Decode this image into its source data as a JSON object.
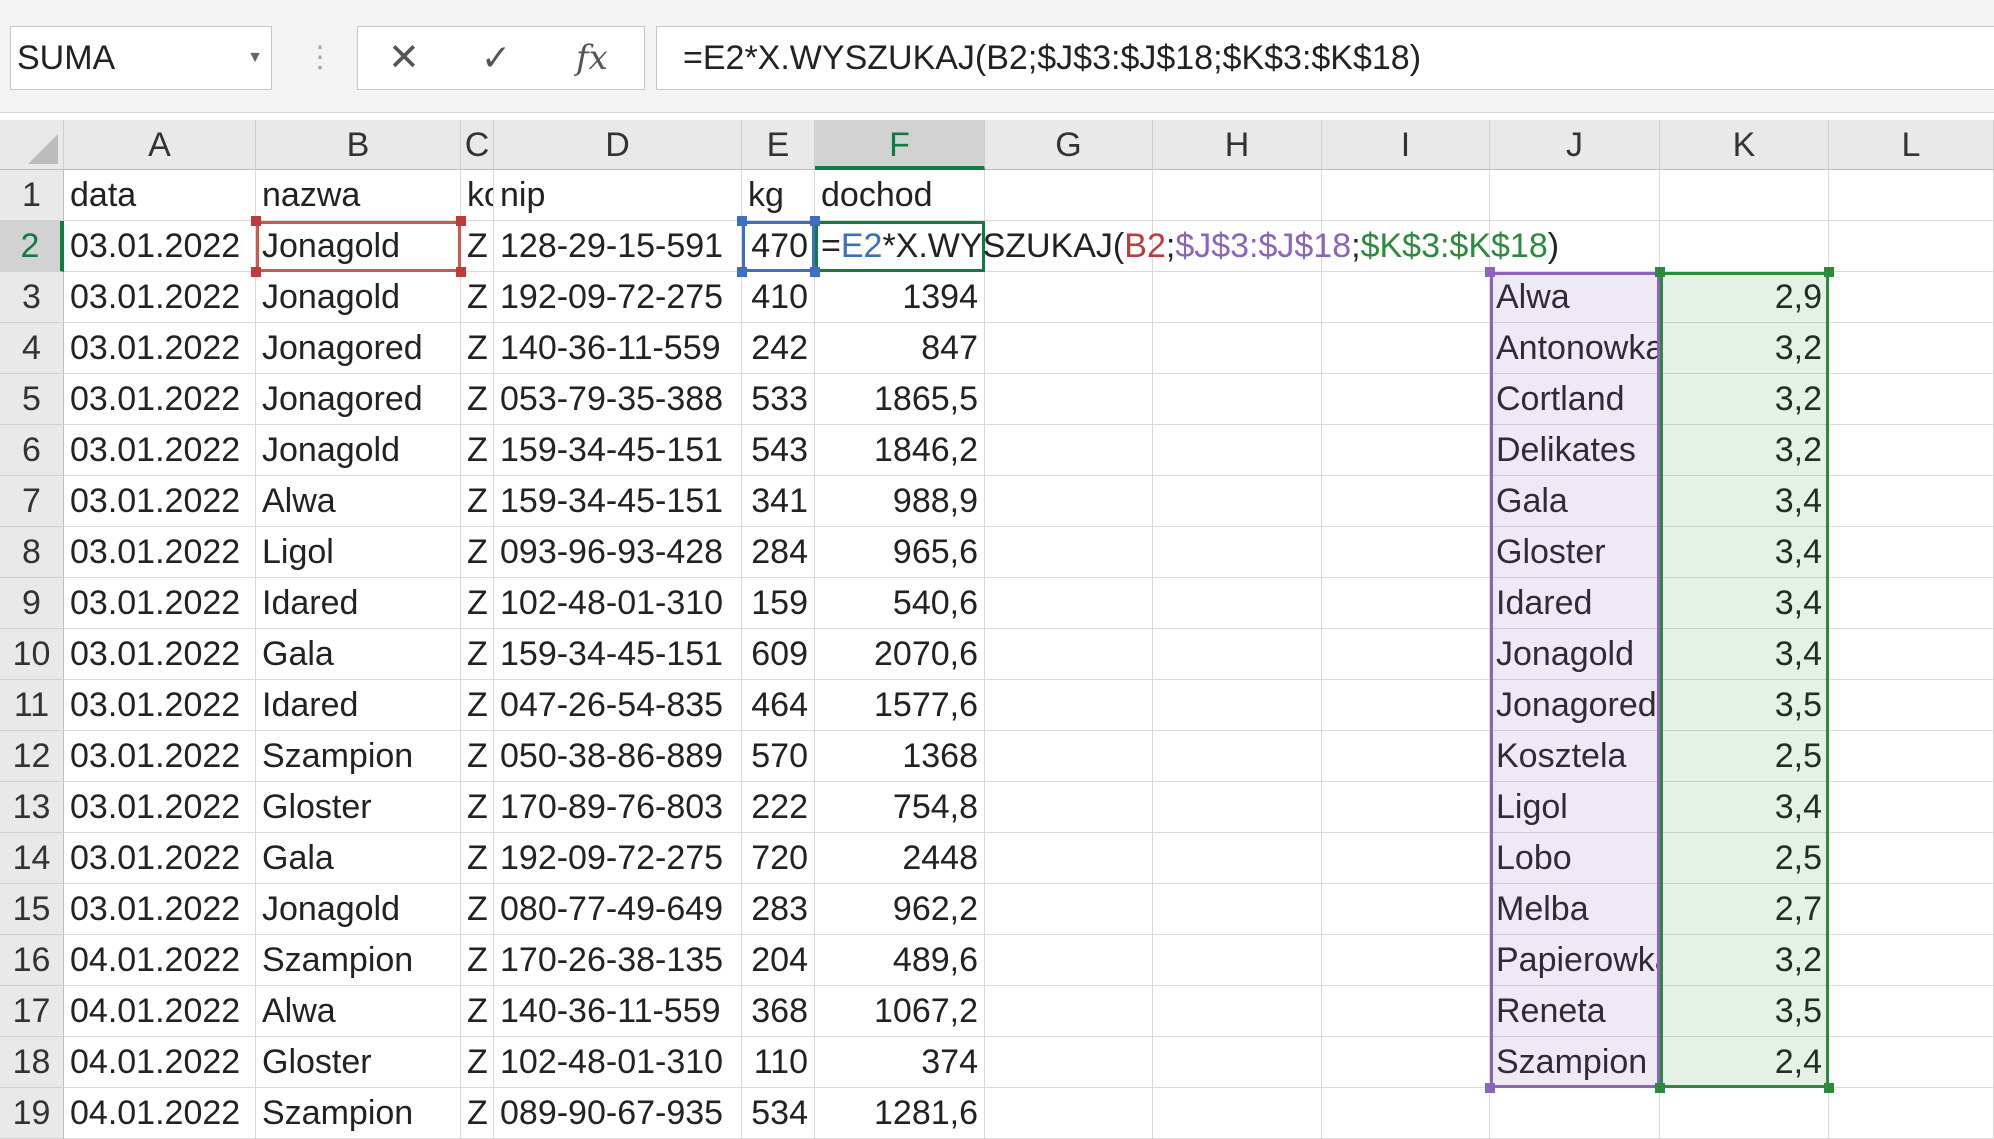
{
  "namebox": {
    "value": "SUMA"
  },
  "formula_buttons": {
    "cancel": "✕",
    "enter": "✓",
    "fx": "fx"
  },
  "formula_bar": {
    "value": "=E2*X.WYSZUKAJ(B2;$J$3:$J$18;$K$3:$K$18)"
  },
  "columns": [
    "A",
    "B",
    "C",
    "D",
    "E",
    "F",
    "G",
    "H",
    "I",
    "J",
    "K",
    "L"
  ],
  "active_column": "F",
  "active_row": 2,
  "header_row": {
    "data": "data",
    "nazwa": "nazwa",
    "c": "kod",
    "nip": "nip",
    "kg": "kg",
    "dochod": "dochod"
  },
  "edit_formula": {
    "p1": "=",
    "p2": "E2",
    "p3": "*X.WYSZUKAJ(",
    "p4": "B2",
    "p5": ";",
    "p6": "$J$3:$J$18",
    "p7": ";",
    "p8": "$K$3:$K$18",
    "p9": ")"
  },
  "rows": [
    {
      "r": "2",
      "data": "03.01.2022",
      "nazwa": "Jonagold",
      "c": "Z",
      "nip": "128-29-15-591",
      "kg": "470",
      "dochod": ""
    },
    {
      "r": "3",
      "data": "03.01.2022",
      "nazwa": "Jonagold",
      "c": "Z",
      "nip": "192-09-72-275",
      "kg": "410",
      "dochod": "1394"
    },
    {
      "r": "4",
      "data": "03.01.2022",
      "nazwa": "Jonagored",
      "c": "Z",
      "nip": "140-36-11-559",
      "kg": "242",
      "dochod": "847"
    },
    {
      "r": "5",
      "data": "03.01.2022",
      "nazwa": "Jonagored",
      "c": "Z",
      "nip": "053-79-35-388",
      "kg": "533",
      "dochod": "1865,5"
    },
    {
      "r": "6",
      "data": "03.01.2022",
      "nazwa": "Jonagold",
      "c": "Z",
      "nip": "159-34-45-151",
      "kg": "543",
      "dochod": "1846,2"
    },
    {
      "r": "7",
      "data": "03.01.2022",
      "nazwa": "Alwa",
      "c": "Z",
      "nip": "159-34-45-151",
      "kg": "341",
      "dochod": "988,9"
    },
    {
      "r": "8",
      "data": "03.01.2022",
      "nazwa": "Ligol",
      "c": "Z",
      "nip": "093-96-93-428",
      "kg": "284",
      "dochod": "965,6"
    },
    {
      "r": "9",
      "data": "03.01.2022",
      "nazwa": "Idared",
      "c": "Z",
      "nip": "102-48-01-310",
      "kg": "159",
      "dochod": "540,6"
    },
    {
      "r": "10",
      "data": "03.01.2022",
      "nazwa": "Gala",
      "c": "Z",
      "nip": "159-34-45-151",
      "kg": "609",
      "dochod": "2070,6"
    },
    {
      "r": "11",
      "data": "03.01.2022",
      "nazwa": "Idared",
      "c": "Z",
      "nip": "047-26-54-835",
      "kg": "464",
      "dochod": "1577,6"
    },
    {
      "r": "12",
      "data": "03.01.2022",
      "nazwa": "Szampion",
      "c": "Z",
      "nip": "050-38-86-889",
      "kg": "570",
      "dochod": "1368"
    },
    {
      "r": "13",
      "data": "03.01.2022",
      "nazwa": "Gloster",
      "c": "Z",
      "nip": "170-89-76-803",
      "kg": "222",
      "dochod": "754,8"
    },
    {
      "r": "14",
      "data": "03.01.2022",
      "nazwa": "Gala",
      "c": "Z",
      "nip": "192-09-72-275",
      "kg": "720",
      "dochod": "2448"
    },
    {
      "r": "15",
      "data": "03.01.2022",
      "nazwa": "Jonagold",
      "c": "Z",
      "nip": "080-77-49-649",
      "kg": "283",
      "dochod": "962,2"
    },
    {
      "r": "16",
      "data": "04.01.2022",
      "nazwa": "Szampion",
      "c": "Z",
      "nip": "170-26-38-135",
      "kg": "204",
      "dochod": "489,6"
    },
    {
      "r": "17",
      "data": "04.01.2022",
      "nazwa": "Alwa",
      "c": "Z",
      "nip": "140-36-11-559",
      "kg": "368",
      "dochod": "1067,2"
    },
    {
      "r": "18",
      "data": "04.01.2022",
      "nazwa": "Gloster",
      "c": "Z",
      "nip": "102-48-01-310",
      "kg": "110",
      "dochod": "374"
    },
    {
      "r": "19",
      "data": "04.01.2022",
      "nazwa": "Szampion",
      "c": "Z",
      "nip": "089-90-67-935",
      "kg": "534",
      "dochod": "1281,6"
    }
  ],
  "lookup": [
    {
      "name": "Alwa",
      "price": "2,9"
    },
    {
      "name": "Antonowka",
      "price": "3,2"
    },
    {
      "name": "Cortland",
      "price": "3,2"
    },
    {
      "name": "Delikates",
      "price": "3,2"
    },
    {
      "name": "Gala",
      "price": "3,4"
    },
    {
      "name": "Gloster",
      "price": "3,4"
    },
    {
      "name": "Idared",
      "price": "3,4"
    },
    {
      "name": "Jonagold",
      "price": "3,4"
    },
    {
      "name": "Jonagored",
      "price": "3,5"
    },
    {
      "name": "Kosztela",
      "price": "2,5"
    },
    {
      "name": "Ligol",
      "price": "3,4"
    },
    {
      "name": "Lobo",
      "price": "2,5"
    },
    {
      "name": "Melba",
      "price": "2,7"
    },
    {
      "name": "Papierowka",
      "price": "3,2"
    },
    {
      "name": "Reneta",
      "price": "3,5"
    },
    {
      "name": "Szampion",
      "price": "2,4"
    }
  ],
  "colors": {
    "accent": "#107c41",
    "ref_red": "#c0393b",
    "ref_blue": "#3a6fc4",
    "ref_purple": "#8e63bc",
    "ref_green": "#2a8b3b"
  }
}
